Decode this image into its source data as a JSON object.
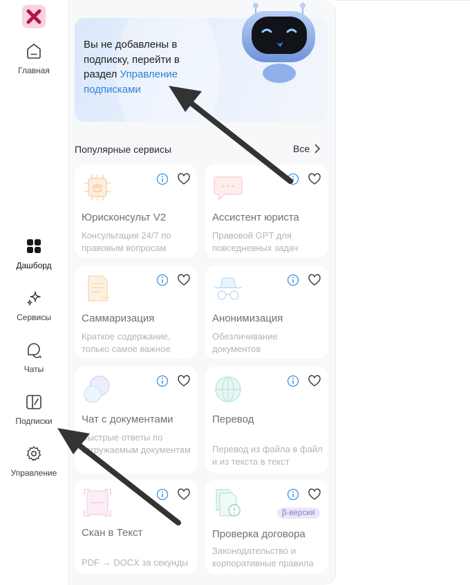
{
  "sidebar": {
    "items": [
      {
        "label": "Главная",
        "icon": "home-icon"
      },
      {
        "label": "Дашборд",
        "icon": "grid-icon"
      },
      {
        "label": "Сервисы",
        "icon": "sparkle-icon"
      },
      {
        "label": "Чаты",
        "icon": "chat-icon"
      },
      {
        "label": "Подписки",
        "icon": "subscription-icon"
      },
      {
        "label": "Управление",
        "icon": "gear-icon"
      }
    ]
  },
  "banner": {
    "text": "Вы не добавлены в подписку, перейти в раздел",
    "link": "Управление подписками"
  },
  "popular": {
    "title": "Популярные сервисы",
    "all_label": "Все"
  },
  "services": [
    {
      "title": "Юрисконсульт V2",
      "desc": "Консультация 24/7 по правовым вопросам",
      "icon": "graduation-chip-icon"
    },
    {
      "title": "Ассистент юриста",
      "desc": "Правовой GPT для повседневных задач",
      "icon": "chat-bubble-icon"
    },
    {
      "title": "Саммаризация",
      "desc": "Краткое содержание, только самое важное",
      "icon": "document-icon"
    },
    {
      "title": "Анонимизация",
      "desc": "Обезличивание документов",
      "icon": "incognito-icon"
    },
    {
      "title": "Чат с документами",
      "desc": "Быстрые ответы по загружаемым документам",
      "icon": "chat-doc-icon"
    },
    {
      "title": "Перевод",
      "desc": "Перевод из файла в файл и из текста в текст",
      "icon": "globe-icon"
    },
    {
      "title": "Скан в Текст",
      "desc": "PDF → DOCX за секунды",
      "icon": "scan-icon"
    },
    {
      "title": "Проверка договора",
      "desc": "Законодательство и корпоративные правила",
      "icon": "contract-check-icon",
      "badge": "β-версия"
    }
  ],
  "colors": {
    "accent_link": "#2f82d6",
    "info_icon": "#3b8ee0",
    "arrow": "#333333",
    "logo_bg": "#f7d3e0",
    "logo_x": "#b3124f"
  }
}
